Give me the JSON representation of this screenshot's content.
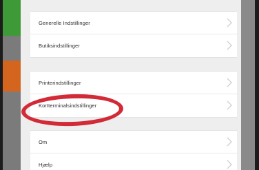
{
  "settings": {
    "groups": [
      {
        "items": [
          {
            "label": "Generelle Indstillinger"
          },
          {
            "label": "Butiksindstillinger"
          }
        ]
      },
      {
        "items": [
          {
            "label": "Printerindstillinger"
          },
          {
            "label": "Kortterminalsindstillinger"
          }
        ]
      },
      {
        "items": [
          {
            "label": "Om"
          },
          {
            "label": "Hjælp"
          }
        ]
      }
    ]
  },
  "icons": {
    "row_chevron": "chevron-right-icon"
  },
  "colors": {
    "highlight": "#d22a36",
    "sidebar_green": "#3d9a36",
    "sidebar_orange": "#d3651f"
  }
}
